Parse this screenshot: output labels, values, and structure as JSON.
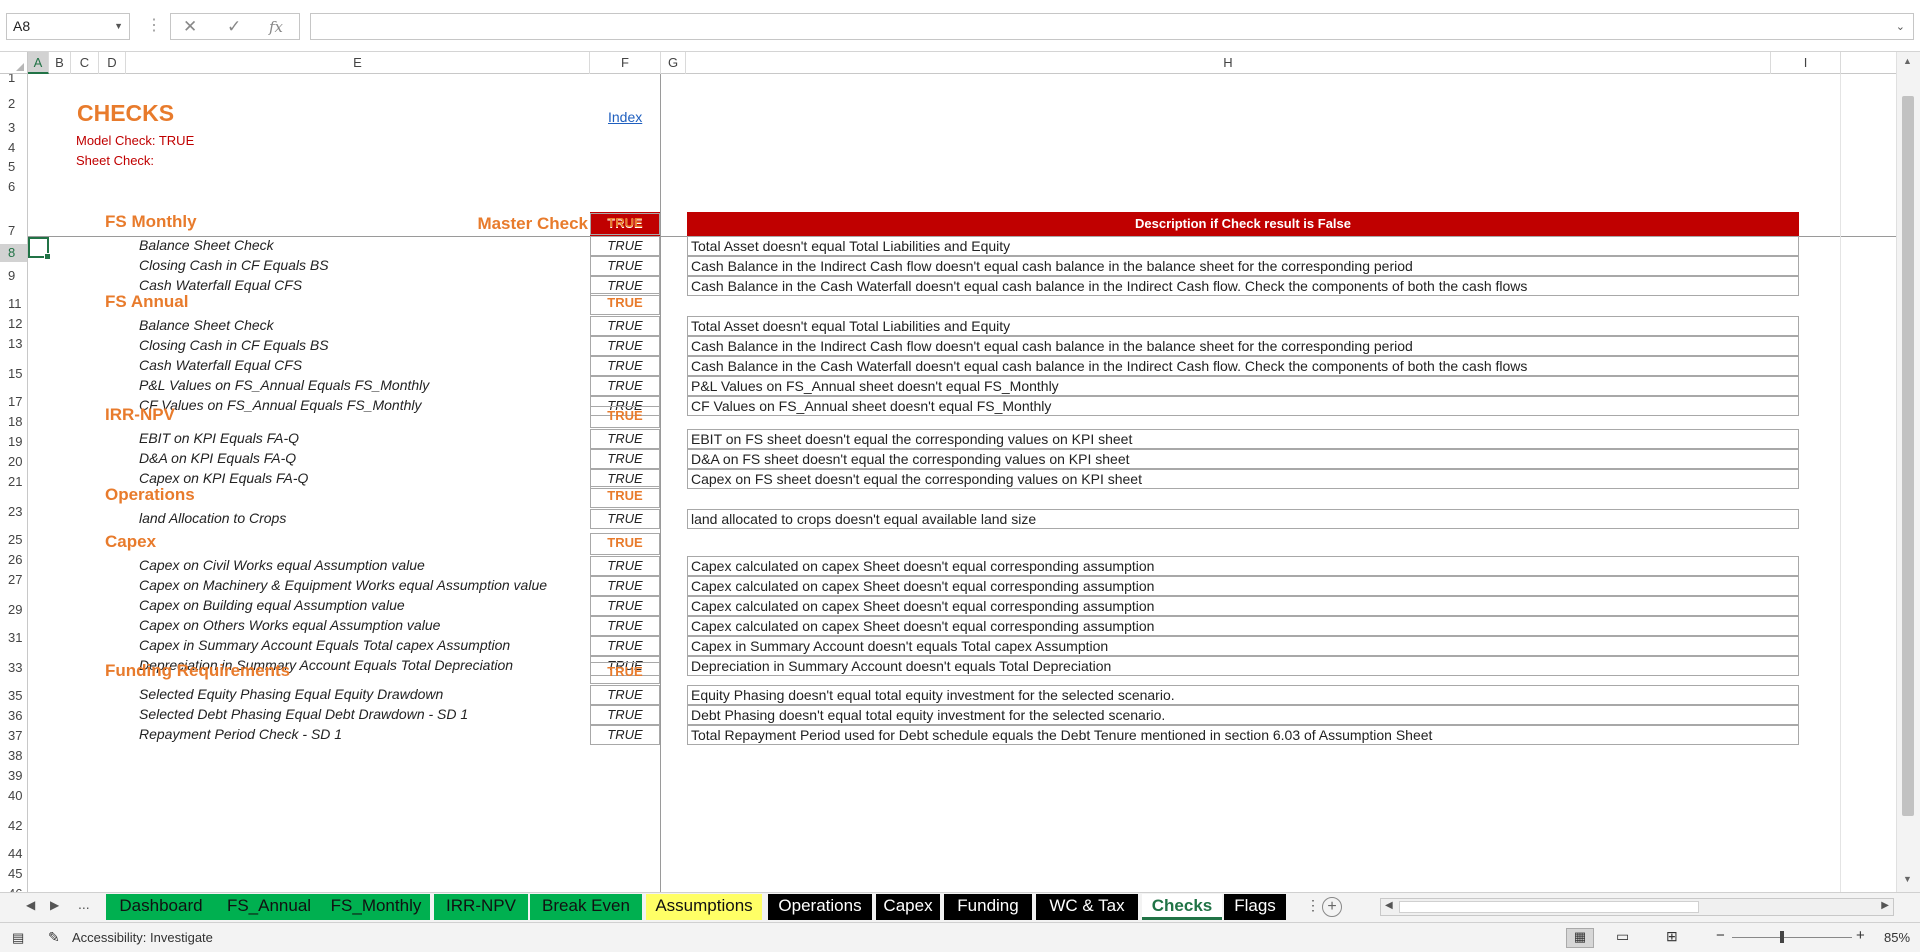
{
  "formula_bar": {
    "name_box": "A8",
    "cancel_icon": "✕",
    "enter_icon": "✓",
    "fx": "fx",
    "formula": ""
  },
  "columns": [
    "A",
    "B",
    "C",
    "D",
    "E",
    "F",
    "G",
    "H",
    "I"
  ],
  "rows": [
    "1",
    "2",
    "3",
    "4",
    "5",
    "6",
    "7",
    "8",
    "9",
    "11",
    "12",
    "13",
    "15",
    "17",
    "18",
    "19",
    "20",
    "21",
    "23",
    "25",
    "26",
    "27",
    "29",
    "31",
    "33",
    "35",
    "36",
    "37",
    "38",
    "39",
    "40",
    "42",
    "44",
    "45",
    "46"
  ],
  "sheet": {
    "title": "CHECKS",
    "model_check": "Model Check: TRUE",
    "sheet_check": "Sheet Check:",
    "index_link": "Index",
    "master_check_label": "Master Check",
    "master_check_value": "TRUE",
    "description_header": "Description if Check result is False",
    "sections": [
      {
        "name": "FS Monthly",
        "value": "TRUE",
        "checks": [
          {
            "name": "Balance Sheet Check",
            "value": "TRUE",
            "desc": "Total Asset doesn't equal Total Liabilities and Equity"
          },
          {
            "name": "Closing Cash in CF Equals BS",
            "value": "TRUE",
            "desc": "Cash Balance in the Indirect Cash flow doesn't equal cash balance in the balance sheet for the corresponding period"
          },
          {
            "name": "Cash Waterfall Equal CFS",
            "value": "TRUE",
            "desc": "Cash Balance in the Cash Waterfall doesn't equal cash balance in the Indirect Cash flow. Check the components of both the cash flows"
          }
        ]
      },
      {
        "name": "FS Annual",
        "value": "TRUE",
        "checks": [
          {
            "name": "Balance Sheet Check",
            "value": "TRUE",
            "desc": "Total Asset doesn't equal Total Liabilities and Equity"
          },
          {
            "name": "Closing Cash in CF Equals BS",
            "value": "TRUE",
            "desc": "Cash Balance in the Indirect Cash flow doesn't equal cash balance in the balance sheet for the corresponding period"
          },
          {
            "name": "Cash Waterfall Equal CFS",
            "value": "TRUE",
            "desc": "Cash Balance in the Cash Waterfall doesn't equal cash balance in the Indirect Cash flow. Check the components of both the cash flows"
          },
          {
            "name": "P&L Values on FS_Annual Equals FS_Monthly",
            "value": "TRUE",
            "desc": "P&L Values on FS_Annual sheet doesn't equal FS_Monthly"
          },
          {
            "name": "CF Values on FS_Annual Equals FS_Monthly",
            "value": "TRUE",
            "desc": "CF Values on FS_Annual sheet doesn't equal FS_Monthly"
          }
        ]
      },
      {
        "name": "IRR-NPV",
        "value": "TRUE",
        "checks": [
          {
            "name": "EBIT on KPI Equals FA-Q",
            "value": "TRUE",
            "desc": "EBIT on FS sheet doesn't equal the corresponding values on KPI sheet"
          },
          {
            "name": "D&A on KPI Equals FA-Q",
            "value": "TRUE",
            "desc": "D&A on FS sheet doesn't equal the corresponding values on KPI sheet"
          },
          {
            "name": "Capex on KPI Equals FA-Q",
            "value": "TRUE",
            "desc": "Capex on FS sheet doesn't equal the corresponding values on KPI sheet"
          }
        ]
      },
      {
        "name": "Operations",
        "value": "TRUE",
        "checks": [
          {
            "name": "land Allocation to Crops",
            "value": "TRUE",
            "desc": "land allocated to crops doesn't equal available land size"
          }
        ]
      },
      {
        "name": "Capex",
        "value": "TRUE",
        "checks": [
          {
            "name": "Capex on Civil Works equal Assumption value",
            "value": "TRUE",
            "desc": "Capex calculated on capex Sheet doesn't equal corresponding assumption"
          },
          {
            "name": "Capex on Machinery & Equipment Works equal Assumption value",
            "value": "TRUE",
            "desc": "Capex calculated on capex Sheet doesn't equal corresponding assumption"
          },
          {
            "name": "Capex on Building equal Assumption value",
            "value": "TRUE",
            "desc": "Capex calculated on capex Sheet doesn't equal corresponding assumption"
          },
          {
            "name": "Capex on Others Works equal Assumption value",
            "value": "TRUE",
            "desc": "Capex calculated on capex Sheet doesn't equal corresponding assumption"
          },
          {
            "name": "Capex in Summary Account Equals Total capex Assumption",
            "value": "TRUE",
            "desc": "Capex in Summary Account doesn't equals Total capex Assumption"
          },
          {
            "name": "Depreciation in Summary Account Equals Total Depreciation",
            "value": "TRUE",
            "desc": "Depreciation in Summary Account doesn't equals Total Depreciation"
          }
        ]
      },
      {
        "name": "Funding Requirements",
        "value": "TRUE",
        "checks": [
          {
            "name": "Selected Equity Phasing Equal Equity Drawdown",
            "value": "TRUE",
            "desc": "Equity Phasing doesn't equal total equity investment for the selected scenario."
          },
          {
            "name": "Selected Debt Phasing Equal Debt Drawdown - SD 1",
            "value": "TRUE",
            "desc": "Debt Phasing doesn't equal total equity investment for the selected scenario."
          },
          {
            "name": "Repayment Period Check - SD 1",
            "value": "TRUE",
            "desc": "Total Repayment Period used for Debt schedule equals the Debt Tenure mentioned in section 6.03 of Assumption Sheet"
          }
        ]
      }
    ]
  },
  "tabs": [
    {
      "label": "Dashboard",
      "style": "green"
    },
    {
      "label": "FS_Annual",
      "style": "green"
    },
    {
      "label": "FS_Monthly",
      "style": "green"
    },
    {
      "label": "IRR-NPV",
      "style": "green"
    },
    {
      "label": "Break Even",
      "style": "green"
    },
    {
      "label": "Assumptions",
      "style": "yellow"
    },
    {
      "label": "Operations",
      "style": "black"
    },
    {
      "label": "Capex",
      "style": "black"
    },
    {
      "label": "Funding",
      "style": "black"
    },
    {
      "label": "WC & Tax",
      "style": "black"
    },
    {
      "label": "Checks",
      "style": "active"
    },
    {
      "label": "Flags",
      "style": "black"
    }
  ],
  "tab_ellipsis": "...",
  "status": {
    "accessibility": "Accessibility: Investigate",
    "zoom": "85%"
  },
  "colors": {
    "accent": "#217346",
    "orange": "#e87b2c",
    "red": "#c00000",
    "tab_green": "#00b050",
    "tab_yellow": "#ffff66"
  }
}
